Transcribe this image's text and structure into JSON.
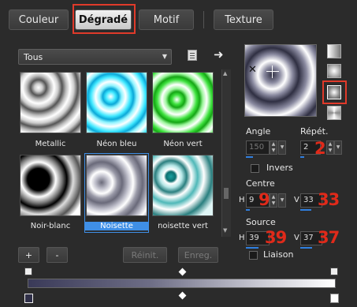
{
  "tabs": [
    {
      "label": "Couleur"
    },
    {
      "label": "Dégradé"
    },
    {
      "label": "Motif"
    },
    {
      "label": "Texture"
    }
  ],
  "filter": {
    "selected": "Tous"
  },
  "presets": [
    {
      "label": "Metallic"
    },
    {
      "label": "Néon bleu"
    },
    {
      "label": "Néon vert"
    },
    {
      "label": "Noir-blanc"
    },
    {
      "label": "Noisette"
    },
    {
      "label": "noisette vert"
    }
  ],
  "angle": {
    "label": "Angle",
    "value": "150"
  },
  "repeat": {
    "label": "Répét.",
    "value": "2",
    "annotation": "2"
  },
  "invert": {
    "label": "Invers"
  },
  "centre": {
    "label": "Centre",
    "h_label": "H",
    "h_value": "9",
    "h_annotation": "9",
    "v_label": "V",
    "v_value": "33",
    "v_annotation": "33"
  },
  "source": {
    "label": "Source",
    "h_label": "H",
    "h_value": "39",
    "h_annotation": "39",
    "v_label": "V",
    "v_value": "37",
    "v_annotation": "37"
  },
  "link": {
    "label": "Liaison"
  },
  "buttons": {
    "add": "+",
    "remove": "-",
    "reset": "Réinit.",
    "save": "Enreg."
  },
  "colors": {
    "accent": "#3f8fe6",
    "highlight": "#e03a2a"
  }
}
